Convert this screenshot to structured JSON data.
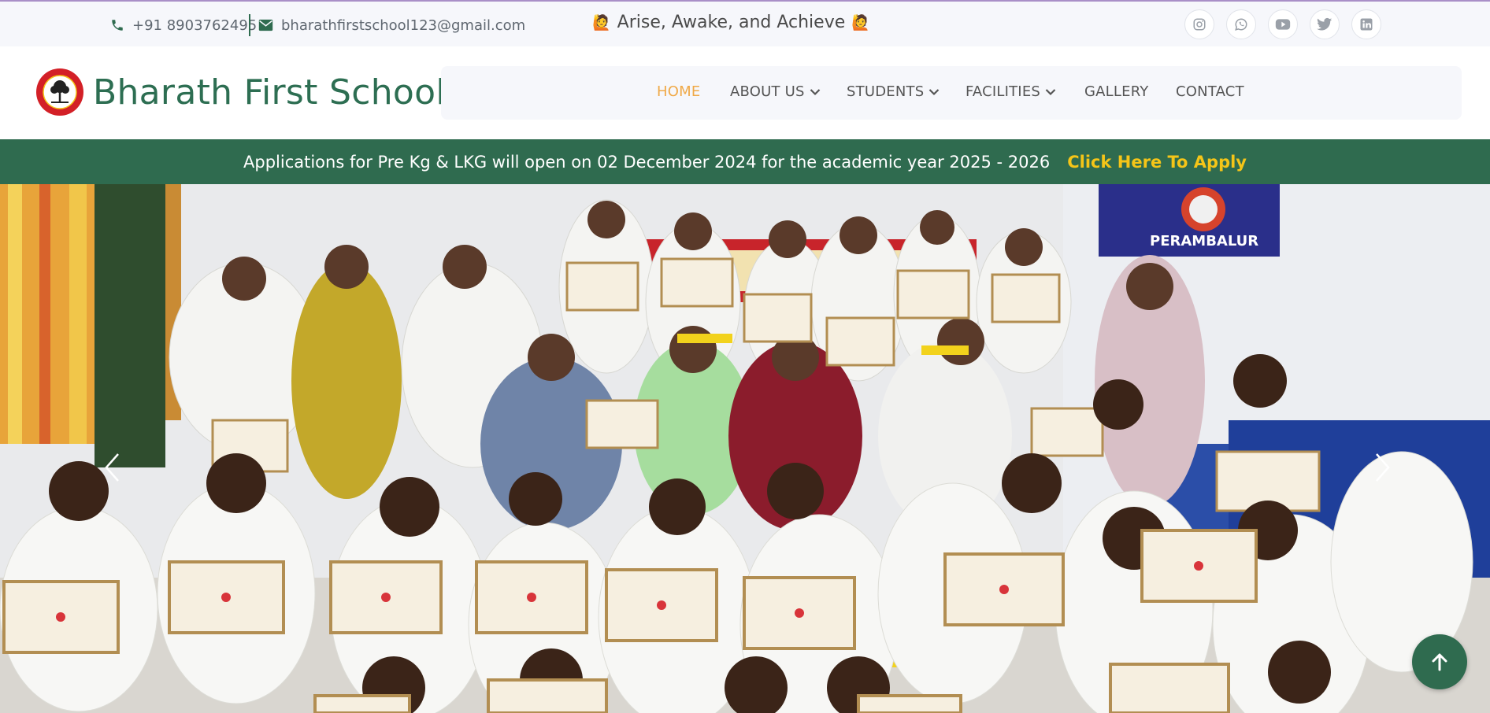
{
  "topbar": {
    "phone": "+91 8903762495",
    "email": "bharathfirstschool123@gmail.com",
    "tagline": "Arise, Awake, and Achieve",
    "tagline_emoji": "🙋",
    "socials": [
      "instagram-icon",
      "whatsapp-icon",
      "youtube-icon",
      "twitter-icon",
      "linkedin-icon"
    ]
  },
  "header": {
    "brand": "Bharath First School",
    "nav": [
      {
        "label": "HOME",
        "active": true,
        "dropdown": false
      },
      {
        "label": "ABOUT US",
        "active": false,
        "dropdown": true
      },
      {
        "label": "STUDENTS",
        "active": false,
        "dropdown": true
      },
      {
        "label": "FACILITIES",
        "active": false,
        "dropdown": true
      },
      {
        "label": "GALLERY",
        "active": false,
        "dropdown": false
      },
      {
        "label": "CONTACT",
        "active": false,
        "dropdown": false
      }
    ]
  },
  "announcement": {
    "text": "Applications for Pre Kg & LKG will open on 02 December 2024 for the academic year 2025 - 2026",
    "link": "Click Here To Apply"
  },
  "hero": {
    "banner_text": "PERAMBALUR",
    "arrows": [
      "chevron-left-icon",
      "chevron-right-icon"
    ]
  },
  "colors": {
    "brand_green": "#2f6b4f",
    "accent_orange": "#f0a947",
    "link_yellow": "#f5c518",
    "topbar_bg": "#f6f7fb"
  }
}
